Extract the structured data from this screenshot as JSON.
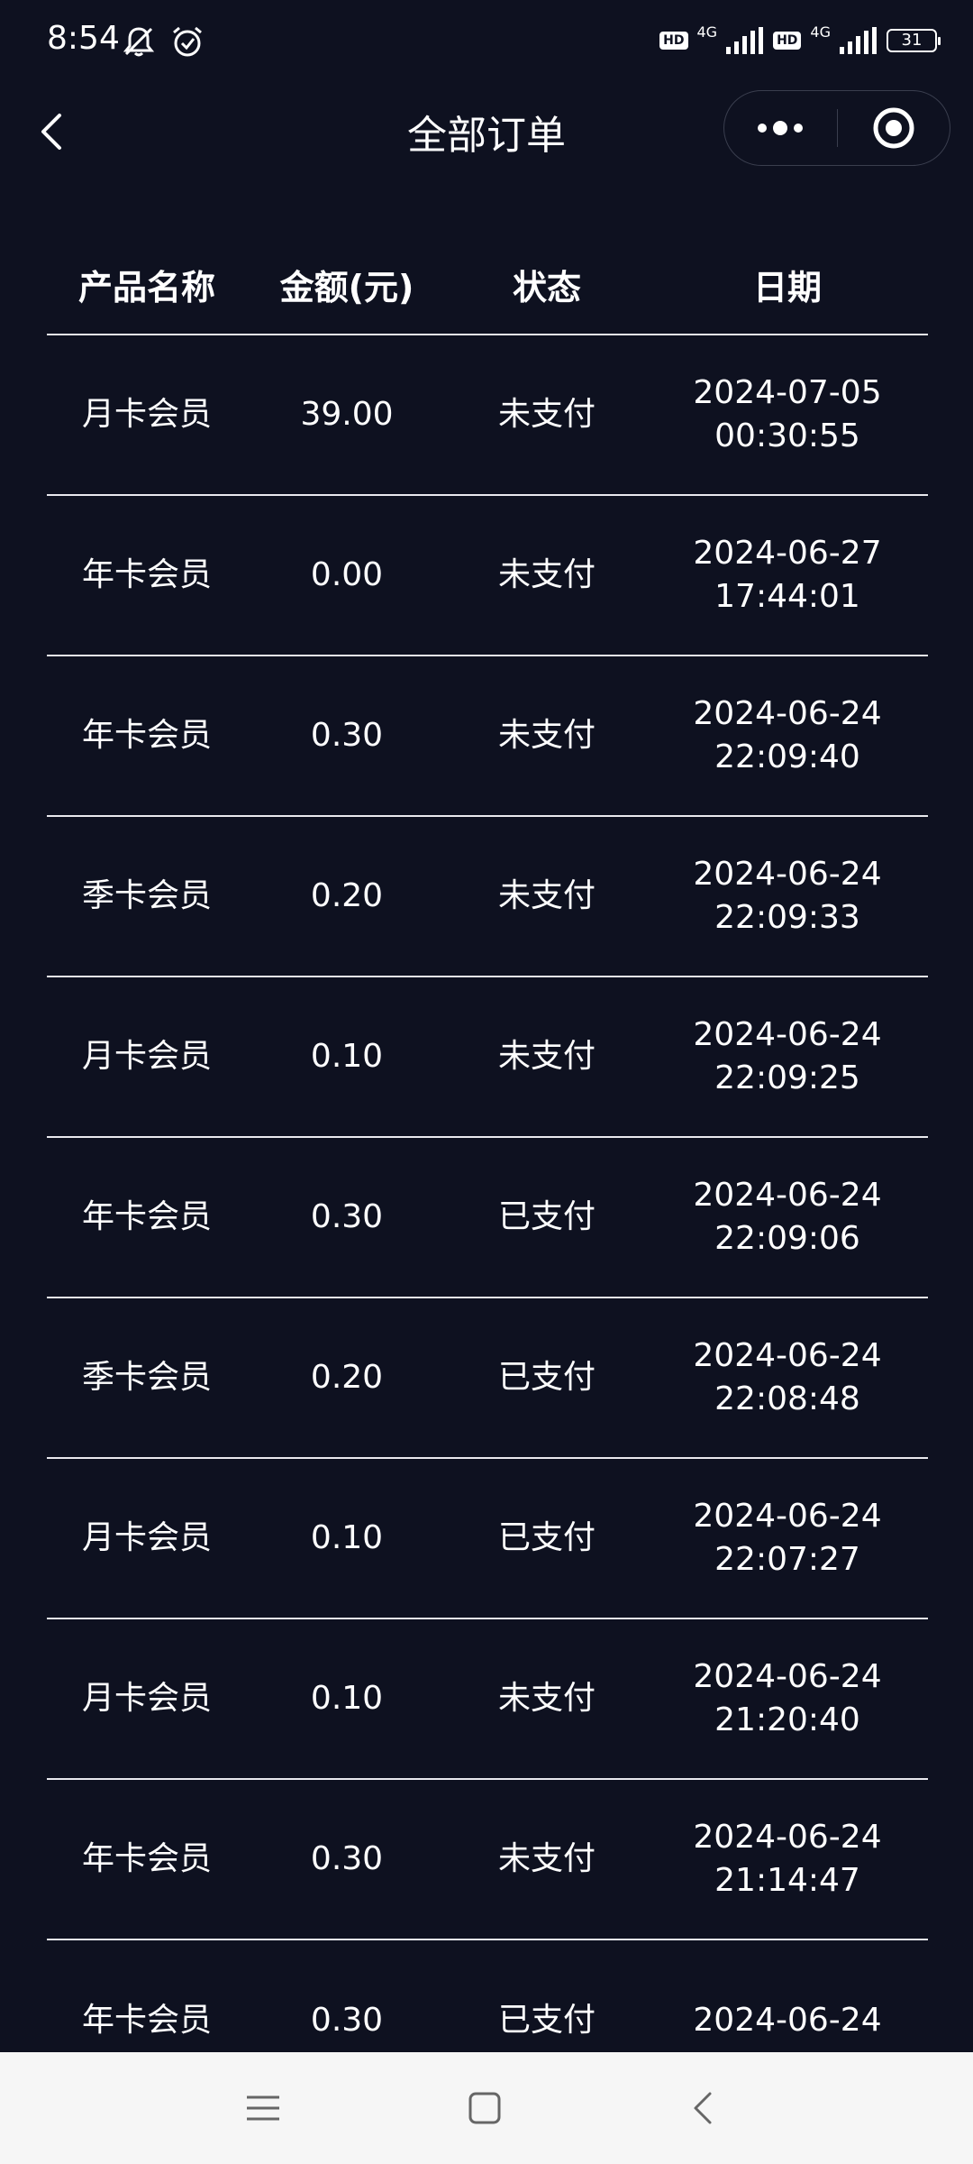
{
  "status_bar": {
    "time": "8:54",
    "icons": [
      "muted-bell-icon",
      "alarm-icon"
    ],
    "sim1_label": "HD",
    "sim1_network": "4G",
    "sim2_label": "HD",
    "sim2_network": "4G",
    "battery_level": "31"
  },
  "header": {
    "title": "全部订单"
  },
  "table": {
    "columns": [
      "产品名称",
      "金额(元)",
      "状态",
      "日期"
    ],
    "rows": [
      {
        "product": "月卡会员",
        "amount": "39.00",
        "status": "未支付",
        "date": "2024-07-05",
        "time": "00:30:55"
      },
      {
        "product": "年卡会员",
        "amount": "0.00",
        "status": "未支付",
        "date": "2024-06-27",
        "time": "17:44:01"
      },
      {
        "product": "年卡会员",
        "amount": "0.30",
        "status": "未支付",
        "date": "2024-06-24",
        "time": "22:09:40"
      },
      {
        "product": "季卡会员",
        "amount": "0.20",
        "status": "未支付",
        "date": "2024-06-24",
        "time": "22:09:33"
      },
      {
        "product": "月卡会员",
        "amount": "0.10",
        "status": "未支付",
        "date": "2024-06-24",
        "time": "22:09:25"
      },
      {
        "product": "年卡会员",
        "amount": "0.30",
        "status": "已支付",
        "date": "2024-06-24",
        "time": "22:09:06"
      },
      {
        "product": "季卡会员",
        "amount": "0.20",
        "status": "已支付",
        "date": "2024-06-24",
        "time": "22:08:48"
      },
      {
        "product": "月卡会员",
        "amount": "0.10",
        "status": "已支付",
        "date": "2024-06-24",
        "time": "22:07:27"
      },
      {
        "product": "月卡会员",
        "amount": "0.10",
        "status": "未支付",
        "date": "2024-06-24",
        "time": "21:20:40"
      },
      {
        "product": "年卡会员",
        "amount": "0.30",
        "status": "未支付",
        "date": "2024-06-24",
        "time": "21:14:47"
      },
      {
        "product": "年卡会员",
        "amount": "0.30",
        "status": "已支付",
        "date": "2024-06-24",
        "time": ""
      }
    ]
  },
  "nav_bar": {
    "icons": [
      "menu-icon",
      "home-icon",
      "back-icon"
    ]
  },
  "colors": {
    "background": "#0e1120",
    "text": "#ffffff",
    "divider": "#e9e9ee",
    "nav_background": "#f6f6f6"
  }
}
